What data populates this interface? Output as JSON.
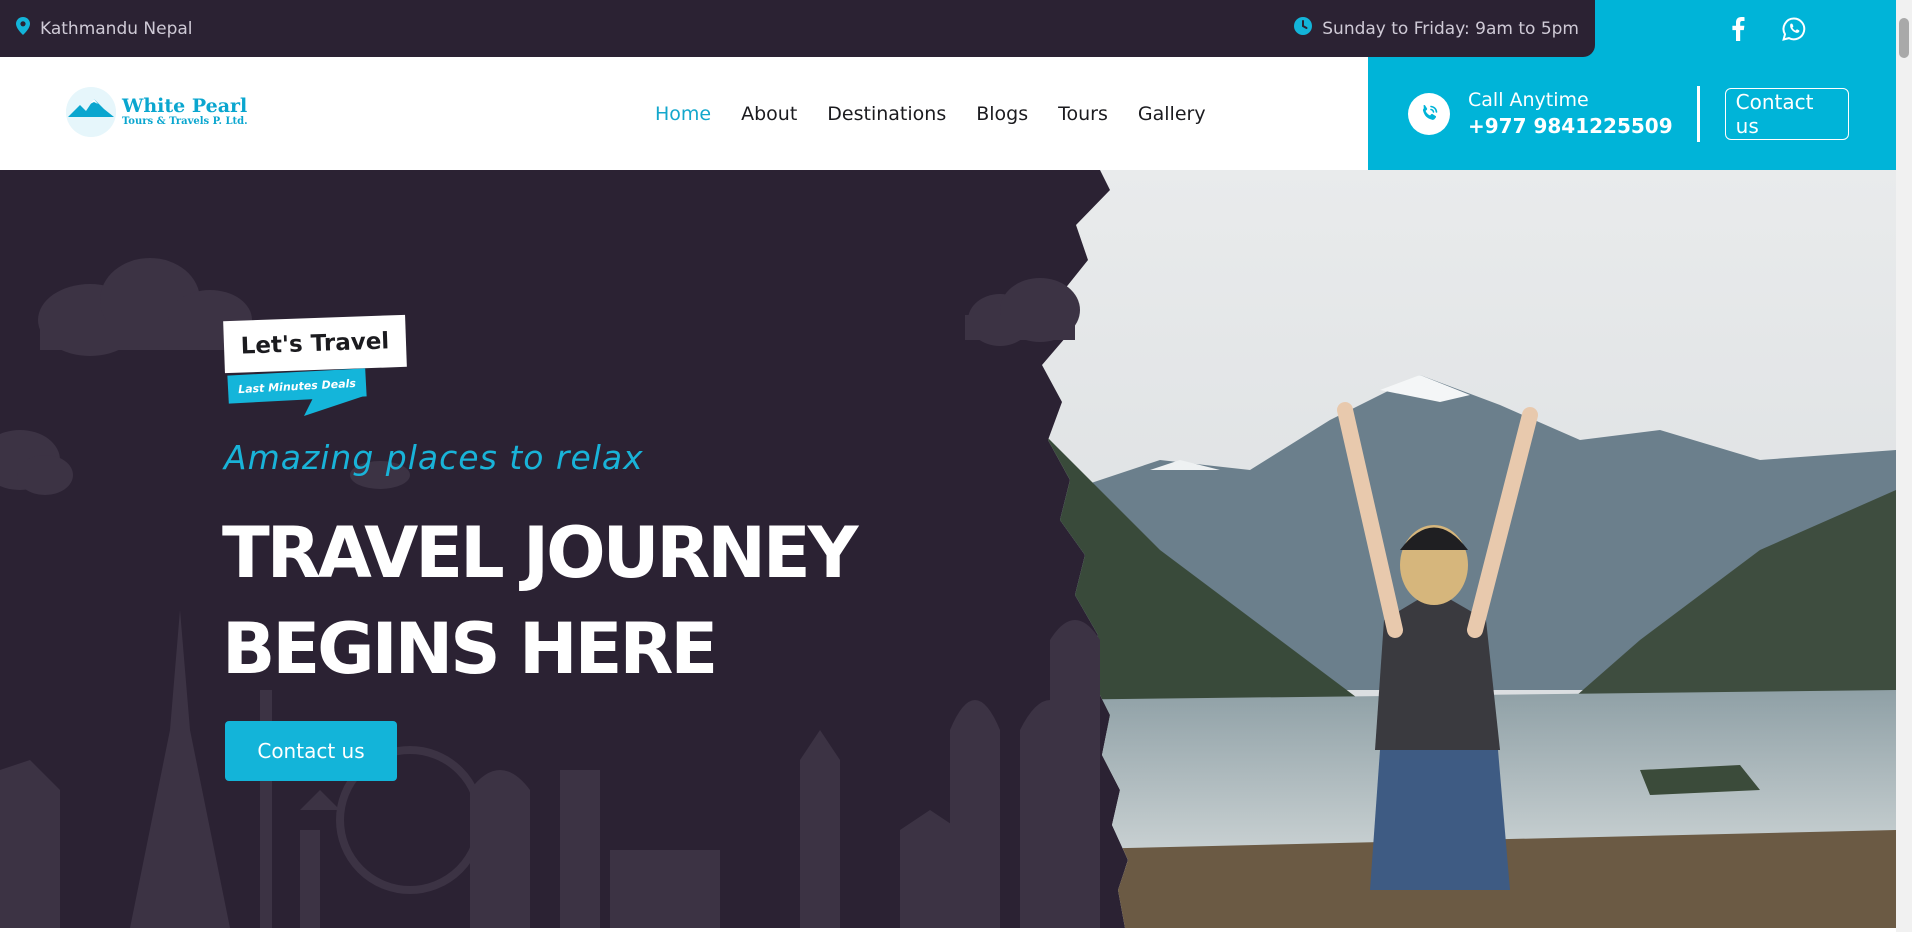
{
  "topbar": {
    "location": "Kathmandu Nepal",
    "hours": "Sunday to Friday: 9am to 5pm",
    "social": [
      {
        "icon": "facebook-icon"
      },
      {
        "icon": "whatsapp-icon"
      }
    ]
  },
  "logo": {
    "line1": "White Pearl",
    "line2": "Tours & Travels P. Ltd."
  },
  "nav": {
    "items": [
      {
        "label": "Home",
        "active": true
      },
      {
        "label": "About"
      },
      {
        "label": "Destinations"
      },
      {
        "label": "Blogs"
      },
      {
        "label": "Tours"
      },
      {
        "label": "Gallery"
      }
    ],
    "call_label": "Call Anytime",
    "call_number": "+977 9841225509",
    "contact_label": "Contact us"
  },
  "hero": {
    "badge_title": "Let's Travel",
    "badge_sub": "Last Minutes Deals",
    "tagline": "Amazing places to relax",
    "headline_1": "TRAVEL JOURNEY",
    "headline_2": "BEGINS HERE",
    "cta_label": "Contact us"
  },
  "colors": {
    "accent": "#00b4d8",
    "dark": "#2b2233",
    "white": "#ffffff"
  }
}
